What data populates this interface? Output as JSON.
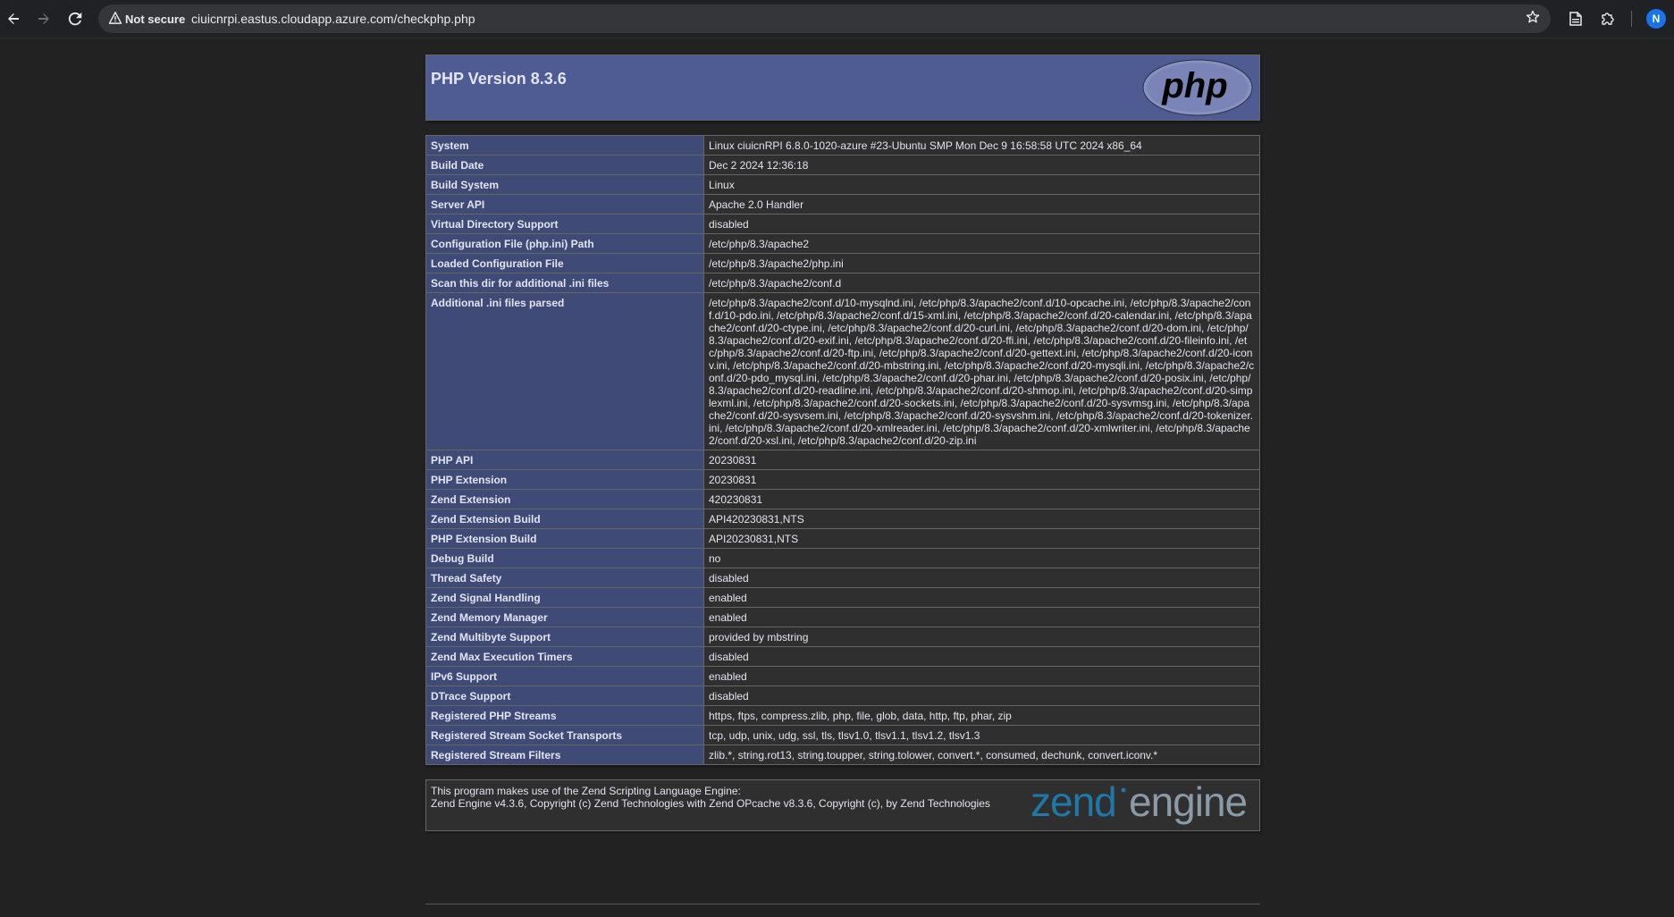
{
  "browser": {
    "security_label": "Not secure",
    "url": "ciuicnrpi.eastus.cloudapp.azure.com/checkphp.php",
    "profile_initial": "N",
    "icons": {
      "back": "back-arrow-icon",
      "forward": "forward-arrow-icon",
      "reload": "reload-icon",
      "warning": "warning-triangle-icon",
      "bookmark": "star-icon",
      "reading_list": "document-icon",
      "extensions": "puzzle-icon"
    }
  },
  "header": {
    "title": "PHP Version 8.3.6",
    "logo_text": "php"
  },
  "rows": [
    {
      "label": "System",
      "value": "Linux ciuicnRPI 6.8.0-1020-azure #23-Ubuntu SMP Mon Dec 9 16:58:58 UTC 2024 x86_64"
    },
    {
      "label": "Build Date",
      "value": "Dec 2 2024 12:36:18"
    },
    {
      "label": "Build System",
      "value": "Linux"
    },
    {
      "label": "Server API",
      "value": "Apache 2.0 Handler"
    },
    {
      "label": "Virtual Directory Support",
      "value": "disabled"
    },
    {
      "label": "Configuration File (php.ini) Path",
      "value": "/etc/php/8.3/apache2"
    },
    {
      "label": "Loaded Configuration File",
      "value": "/etc/php/8.3/apache2/php.ini"
    },
    {
      "label": "Scan this dir for additional .ini files",
      "value": "/etc/php/8.3/apache2/conf.d"
    },
    {
      "label": "Additional .ini files parsed",
      "value": "/etc/php/8.3/apache2/conf.d/10-mysqlnd.ini, /etc/php/8.3/apache2/conf.d/10-opcache.ini, /etc/php/8.3/apache2/conf.d/10-pdo.ini, /etc/php/8.3/apache2/conf.d/15-xml.ini, /etc/php/8.3/apache2/conf.d/20-calendar.ini, /etc/php/8.3/apache2/conf.d/20-ctype.ini, /etc/php/8.3/apache2/conf.d/20-curl.ini, /etc/php/8.3/apache2/conf.d/20-dom.ini, /etc/php/8.3/apache2/conf.d/20-exif.ini, /etc/php/8.3/apache2/conf.d/20-ffi.ini, /etc/php/8.3/apache2/conf.d/20-fileinfo.ini, /etc/php/8.3/apache2/conf.d/20-ftp.ini, /etc/php/8.3/apache2/conf.d/20-gettext.ini, /etc/php/8.3/apache2/conf.d/20-iconv.ini, /etc/php/8.3/apache2/conf.d/20-mbstring.ini, /etc/php/8.3/apache2/conf.d/20-mysqli.ini, /etc/php/8.3/apache2/conf.d/20-pdo_mysql.ini, /etc/php/8.3/apache2/conf.d/20-phar.ini, /etc/php/8.3/apache2/conf.d/20-posix.ini, /etc/php/8.3/apache2/conf.d/20-readline.ini, /etc/php/8.3/apache2/conf.d/20-shmop.ini, /etc/php/8.3/apache2/conf.d/20-simplexml.ini, /etc/php/8.3/apache2/conf.d/20-sockets.ini, /etc/php/8.3/apache2/conf.d/20-sysvmsg.ini, /etc/php/8.3/apache2/conf.d/20-sysvsem.ini, /etc/php/8.3/apache2/conf.d/20-sysvshm.ini, /etc/php/8.3/apache2/conf.d/20-tokenizer.ini, /etc/php/8.3/apache2/conf.d/20-xmlreader.ini, /etc/php/8.3/apache2/conf.d/20-xmlwriter.ini, /etc/php/8.3/apache2/conf.d/20-xsl.ini, /etc/php/8.3/apache2/conf.d/20-zip.ini"
    },
    {
      "label": "PHP API",
      "value": "20230831"
    },
    {
      "label": "PHP Extension",
      "value": "20230831"
    },
    {
      "label": "Zend Extension",
      "value": "420230831"
    },
    {
      "label": "Zend Extension Build",
      "value": "API420230831,NTS"
    },
    {
      "label": "PHP Extension Build",
      "value": "API20230831,NTS"
    },
    {
      "label": "Debug Build",
      "value": "no"
    },
    {
      "label": "Thread Safety",
      "value": "disabled"
    },
    {
      "label": "Zend Signal Handling",
      "value": "enabled"
    },
    {
      "label": "Zend Memory Manager",
      "value": "enabled"
    },
    {
      "label": "Zend Multibyte Support",
      "value": "provided by mbstring"
    },
    {
      "label": "Zend Max Execution Timers",
      "value": "disabled"
    },
    {
      "label": "IPv6 Support",
      "value": "enabled"
    },
    {
      "label": "DTrace Support",
      "value": "disabled"
    },
    {
      "label": "Registered PHP Streams",
      "value": "https, ftps, compress.zlib, php, file, glob, data, http, ftp, phar, zip"
    },
    {
      "label": "Registered Stream Socket Transports",
      "value": "tcp, udp, unix, udg, ssl, tls, tlsv1.0, tlsv1.1, tlsv1.2, tlsv1.3"
    },
    {
      "label": "Registered Stream Filters",
      "value": "zlib.*, string.rot13, string.toupper, string.tolower, convert.*, consumed, dechunk, convert.iconv.*"
    }
  ],
  "zend": {
    "line1": "This program makes use of the Zend Scripting Language Engine:",
    "line2": "Zend Engine v4.3.6, Copyright (c) Zend Technologies with Zend OPcache v8.3.6, Copyright (c), by Zend Technologies",
    "logo_text_1": "zend",
    "logo_text_2": "engine"
  },
  "colors": {
    "header_bg": "#4f5b93",
    "label_bg": "#404a77",
    "value_bg": "#2f2f2f",
    "page_bg": "#222222"
  }
}
